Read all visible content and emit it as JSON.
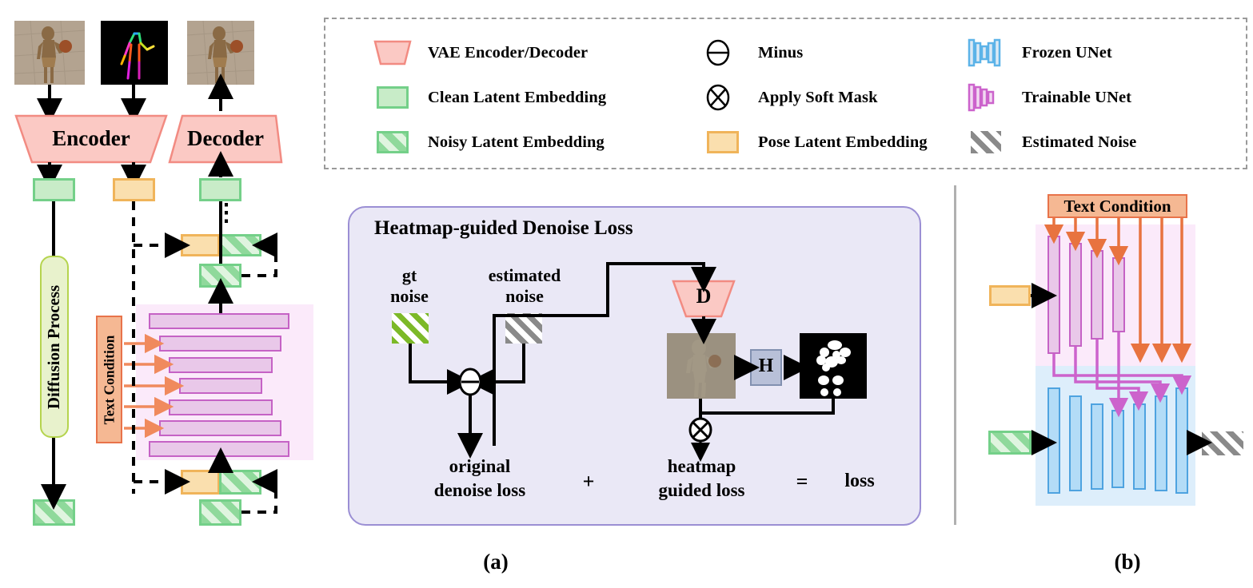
{
  "figure": {
    "caption_a": "(a)",
    "caption_b": "(b)"
  },
  "legend": {
    "items": [
      {
        "id": "vae",
        "icon": "trapezoid-pink-icon",
        "label": "VAE Encoder/Decoder",
        "color": "#fbc9c4"
      },
      {
        "id": "clean",
        "icon": "green-rect-icon",
        "label": "Clean Latent Embedding",
        "color": "#c8ecc8"
      },
      {
        "id": "noisy",
        "icon": "green-striped-rect-icon",
        "label": "Noisy Latent Embedding",
        "color": "#8fd99b"
      },
      {
        "id": "minus",
        "icon": "circle-minus-icon",
        "label": "Minus",
        "color": "#000000"
      },
      {
        "id": "mask",
        "icon": "circle-times-icon",
        "label": "Apply Soft Mask",
        "color": "#000000"
      },
      {
        "id": "pose",
        "icon": "orange-rect-icon",
        "label": "Pose Latent Embedding",
        "color": "#fadfae"
      },
      {
        "id": "frozen",
        "icon": "frozen-unet-icon",
        "label": "Frozen UNet",
        "color": "#5cb3e8"
      },
      {
        "id": "trainable",
        "icon": "trainable-unet-icon",
        "label": "Trainable UNet",
        "color": "#cc63cc"
      },
      {
        "id": "estnoise",
        "icon": "gray-striped-rect-icon",
        "label": "Estimated Noise",
        "color": "#8a8a8a"
      }
    ]
  },
  "panel_a": {
    "encoder_label": "Encoder",
    "decoder_label": "Decoder",
    "diffusion_label": "Diffusion Process",
    "text_condition_label": "Text Condition",
    "vertical_dots": "⋮",
    "images": [
      {
        "name": "input-image",
        "alt": "rendered human figure holding ball"
      },
      {
        "name": "pose-image",
        "alt": "skeleton pose keypoints on black"
      },
      {
        "name": "output-image",
        "alt": "rendered human figure holding ball"
      }
    ]
  },
  "loss_panel": {
    "title": "Heatmap-guided Denoise Loss",
    "gt_noise_label": "gt\nnoise",
    "gt_noise_line1": "gt",
    "gt_noise_line2": "noise",
    "estimated_noise_line1": "estimated",
    "estimated_noise_line2": "noise",
    "decoder_symbol": "D",
    "heatmap_symbol": "H",
    "original_loss_line1": "original",
    "original_loss_line2": "denoise loss",
    "plus_symbol": "+",
    "heatmap_loss_line1": "heatmap",
    "heatmap_loss_line2": "guided loss",
    "equals_symbol": "=",
    "total_loss_label": "loss"
  },
  "panel_b": {
    "text_condition_label": "Text Condition",
    "trainable_block_count": 4,
    "frozen_block_count": 7,
    "text_arrow_count": 7
  },
  "colors": {
    "green_fill": "#c8ecc8",
    "green_border": "#74d089",
    "orange_fill": "#fadfae",
    "orange_border": "#f0b45a",
    "pink_fill": "#fbc9c4",
    "pink_border": "#f08080",
    "purple_fill": "#e9c8e9",
    "purple_border": "#c562c5",
    "purple_bg": "#fbeafa",
    "blue_fill": "#b3dcf7",
    "blue_border": "#4ea3e0",
    "blue_bg": "#ddeefb",
    "loss_panel_bg": "#eae8f6",
    "loss_panel_border": "#9b8fd4",
    "text_condition_fill": "#f5b893",
    "text_condition_border": "#e8734a",
    "diffusion_fill": "#e8f2cc",
    "diffusion_border": "#b5d44e",
    "heatmap_fill": "#b8c0d8",
    "heatmap_border": "#8290b0",
    "legend_border": "#9a9a9a"
  }
}
